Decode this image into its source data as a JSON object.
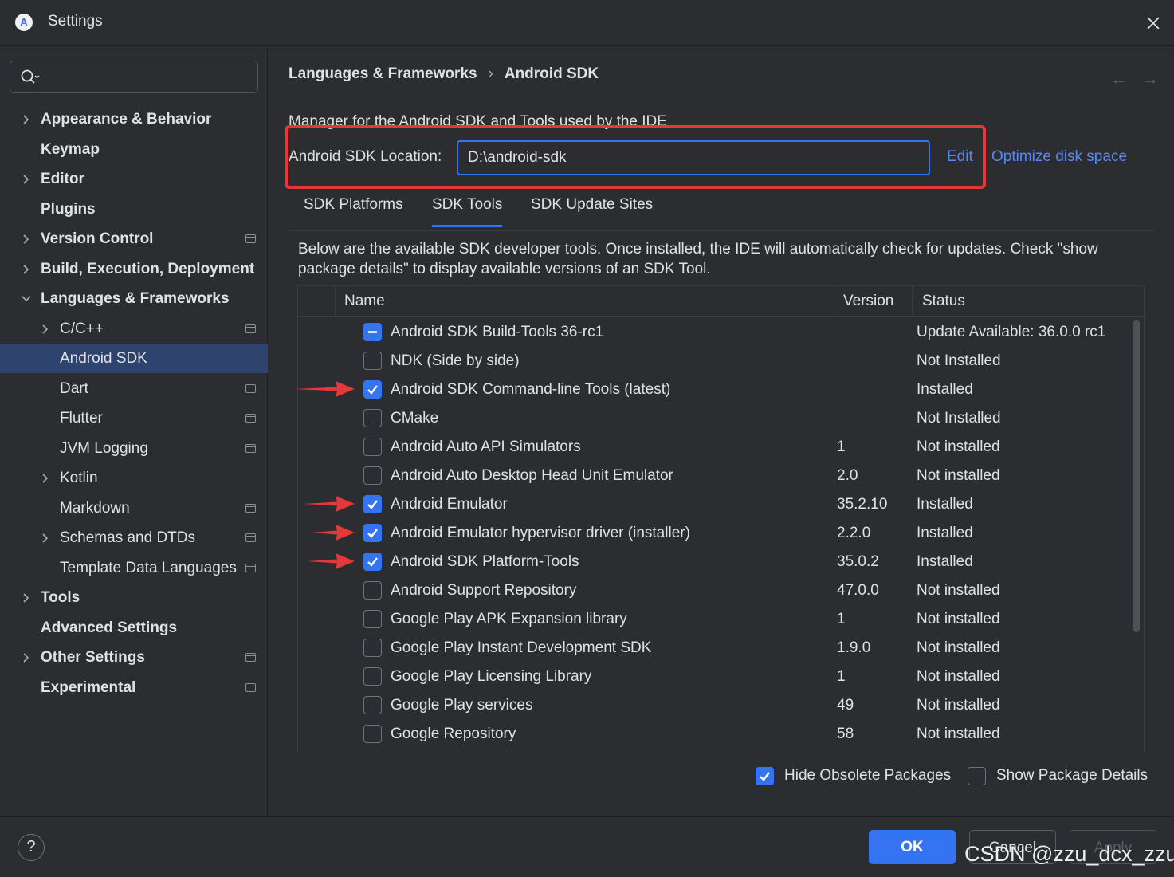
{
  "window": {
    "title": "Settings",
    "app_icon": "A"
  },
  "search": {
    "placeholder": "",
    "value": ""
  },
  "sidebar": {
    "items": [
      {
        "label": "Appearance & Behavior",
        "bold": true,
        "expandable": true,
        "expanded": false,
        "indent": 0,
        "project_icon": false
      },
      {
        "label": "Keymap",
        "bold": true,
        "expandable": false,
        "indent": 0,
        "project_icon": false
      },
      {
        "label": "Editor",
        "bold": true,
        "expandable": true,
        "expanded": false,
        "indent": 0,
        "project_icon": false
      },
      {
        "label": "Plugins",
        "bold": true,
        "expandable": false,
        "indent": 0,
        "project_icon": false
      },
      {
        "label": "Version Control",
        "bold": true,
        "expandable": true,
        "expanded": false,
        "indent": 0,
        "project_icon": true
      },
      {
        "label": "Build, Execution, Deployment",
        "bold": true,
        "expandable": true,
        "expanded": false,
        "indent": 0,
        "project_icon": false
      },
      {
        "label": "Languages & Frameworks",
        "bold": true,
        "expandable": true,
        "expanded": true,
        "indent": 0,
        "project_icon": false
      },
      {
        "label": "C/C++",
        "bold": false,
        "expandable": true,
        "expanded": false,
        "indent": 1,
        "project_icon": true
      },
      {
        "label": "Android SDK",
        "bold": false,
        "expandable": false,
        "indent": 1,
        "project_icon": false,
        "selected": true
      },
      {
        "label": "Dart",
        "bold": false,
        "expandable": false,
        "indent": 1,
        "project_icon": true
      },
      {
        "label": "Flutter",
        "bold": false,
        "expandable": false,
        "indent": 1,
        "project_icon": true
      },
      {
        "label": "JVM Logging",
        "bold": false,
        "expandable": false,
        "indent": 1,
        "project_icon": true
      },
      {
        "label": "Kotlin",
        "bold": false,
        "expandable": true,
        "expanded": false,
        "indent": 1,
        "project_icon": false
      },
      {
        "label": "Markdown",
        "bold": false,
        "expandable": false,
        "indent": 1,
        "project_icon": true
      },
      {
        "label": "Schemas and DTDs",
        "bold": false,
        "expandable": true,
        "expanded": false,
        "indent": 1,
        "project_icon": true
      },
      {
        "label": "Template Data Languages",
        "bold": false,
        "expandable": false,
        "indent": 1,
        "project_icon": true
      },
      {
        "label": "Tools",
        "bold": true,
        "expandable": true,
        "expanded": false,
        "indent": 0,
        "project_icon": false
      },
      {
        "label": "Advanced Settings",
        "bold": true,
        "expandable": false,
        "indent": 0,
        "project_icon": false
      },
      {
        "label": "Other Settings",
        "bold": true,
        "expandable": true,
        "expanded": false,
        "indent": 0,
        "project_icon": true
      },
      {
        "label": "Experimental",
        "bold": true,
        "expandable": false,
        "indent": 0,
        "project_icon": true
      }
    ]
  },
  "breadcrumb": {
    "parent": "Languages & Frameworks",
    "separator": "›",
    "current": "Android SDK"
  },
  "nav_arrows": {
    "back": "←",
    "forward": "→"
  },
  "main": {
    "description": "Manager for the Android SDK and Tools used by the IDE",
    "sdk_location_label": "Android SDK Location:",
    "sdk_location_value": "D:\\android-sdk",
    "edit_link": "Edit",
    "optimize_link": "Optimize disk space",
    "tabs": [
      {
        "label": "SDK Platforms",
        "active": false
      },
      {
        "label": "SDK Tools",
        "active": true
      },
      {
        "label": "SDK Update Sites",
        "active": false
      }
    ],
    "panel_description": "Below are the available SDK developer tools. Once installed, the IDE will automatically check for updates. Check \"show package details\" to display available versions of an SDK Tool.",
    "table": {
      "columns": [
        "Name",
        "Version",
        "Status"
      ],
      "rows": [
        {
          "state": "partial",
          "name": "Android SDK Build-Tools 36-rc1",
          "version": "",
          "status": "Update Available: 36.0.0 rc1",
          "arrow": false
        },
        {
          "state": "unchecked",
          "name": "NDK (Side by side)",
          "version": "",
          "status": "Not Installed",
          "arrow": false
        },
        {
          "state": "checked",
          "name": "Android SDK Command-line Tools (latest)",
          "version": "",
          "status": "Installed",
          "arrow": true
        },
        {
          "state": "unchecked",
          "name": "CMake",
          "version": "",
          "status": "Not Installed",
          "arrow": false
        },
        {
          "state": "unchecked",
          "name": "Android Auto API Simulators",
          "version": "1",
          "status": "Not installed",
          "arrow": false
        },
        {
          "state": "unchecked",
          "name": "Android Auto Desktop Head Unit Emulator",
          "version": "2.0",
          "status": "Not installed",
          "arrow": false
        },
        {
          "state": "checked",
          "name": "Android Emulator",
          "version": "35.2.10",
          "status": "Installed",
          "arrow": true
        },
        {
          "state": "checked",
          "name": "Android Emulator hypervisor driver (installer)",
          "version": "2.2.0",
          "status": "Installed",
          "arrow": true
        },
        {
          "state": "checked",
          "name": "Android SDK Platform-Tools",
          "version": "35.0.2",
          "status": "Installed",
          "arrow": true
        },
        {
          "state": "unchecked",
          "name": "Android Support Repository",
          "version": "47.0.0",
          "status": "Not installed",
          "arrow": false
        },
        {
          "state": "unchecked",
          "name": "Google Play APK Expansion library",
          "version": "1",
          "status": "Not installed",
          "arrow": false
        },
        {
          "state": "unchecked",
          "name": "Google Play Instant Development SDK",
          "version": "1.9.0",
          "status": "Not installed",
          "arrow": false
        },
        {
          "state": "unchecked",
          "name": "Google Play Licensing Library",
          "version": "1",
          "status": "Not installed",
          "arrow": false
        },
        {
          "state": "unchecked",
          "name": "Google Play services",
          "version": "49",
          "status": "Not installed",
          "arrow": false
        },
        {
          "state": "unchecked",
          "name": "Google Repository",
          "version": "58",
          "status": "Not installed",
          "arrow": false
        },
        {
          "state": "unchecked",
          "name": "",
          "version": "",
          "status": "",
          "arrow": false
        }
      ]
    },
    "options": {
      "hide_obsolete": {
        "label": "Hide Obsolete Packages",
        "checked": true
      },
      "show_details": {
        "label": "Show Package Details",
        "checked": false
      }
    }
  },
  "footer": {
    "help": "?",
    "ok": "OK",
    "cancel": "Cancel",
    "apply": "Apply",
    "watermark": "CSDN @zzu_dcx_zzu"
  },
  "colors": {
    "background": "#2b2d30",
    "accent": "#3574f0",
    "link": "#548af7",
    "selection": "#2e436e",
    "highlight_red": "#e5383b",
    "text": "#dfe1e5"
  }
}
